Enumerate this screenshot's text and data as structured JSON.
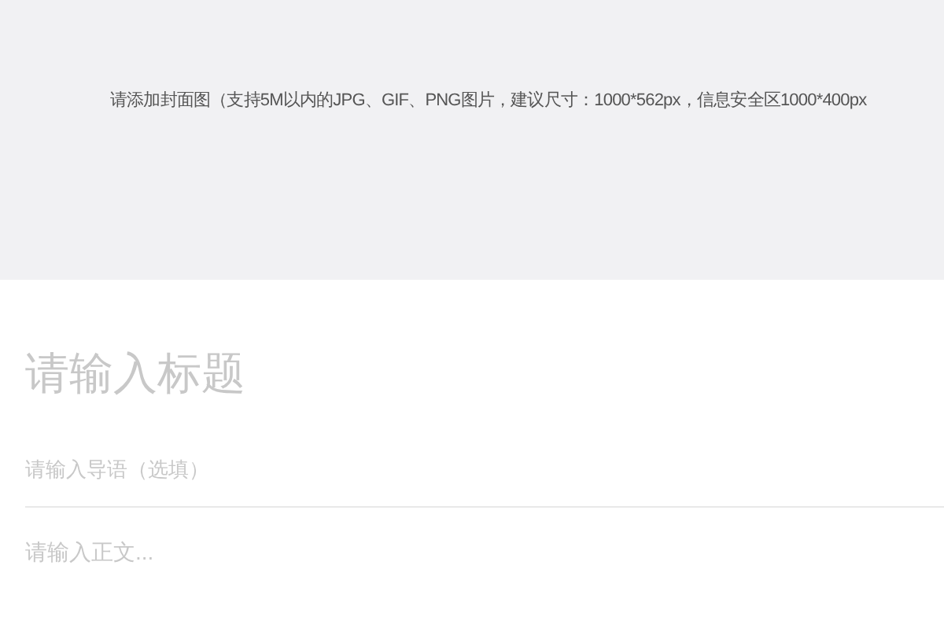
{
  "cover": {
    "placeholder": "请添加封面图（支持5M以内的JPG、GIF、PNG图片，建议尺寸：1000*562px，信息安全区1000*400px"
  },
  "title": {
    "placeholder": "请输入标题"
  },
  "lead": {
    "placeholder": "请输入导语（选填）"
  },
  "body": {
    "placeholder": "请输入正文..."
  }
}
